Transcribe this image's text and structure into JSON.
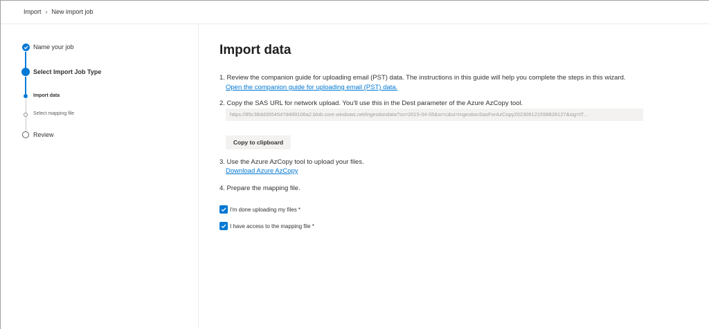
{
  "breadcrumb": {
    "root": "Import",
    "current": "New import job"
  },
  "wizard": {
    "steps": [
      {
        "label": "Name your job",
        "state": "completed"
      },
      {
        "label": "Select Import Job Type",
        "state": "current"
      },
      {
        "label": "Import data",
        "state": "current-substep"
      },
      {
        "label": "Select mapping file",
        "state": "pending-substep"
      },
      {
        "label": "Review",
        "state": "pending"
      }
    ]
  },
  "main": {
    "title": "Import data",
    "step1_text": "1. Review the companion guide for uploading email (PST) data. The instructions in this guide will help you complete the steps in this wizard.",
    "step1_link": "Open the companion guide for uploading email (PST) data.",
    "step2_text": "2. Copy the SAS URL for network upload. You'll use this in the Dest parameter of the Azure AzCopy tool.",
    "sas_url": "https://85c38dd3654547d489106a2.blob.core.windows.net/ingestiondata?sv=2015-04-05&sr=c&si=IngestionSasForAzCopy202306121558828127&sig=tT...",
    "copy_button": "Copy to clipboard",
    "step3_text": "3. Use the Azure AzCopy tool to upload your files.",
    "step3_link": "Download Azure AzCopy",
    "step4_text": "4. Prepare the mapping file.",
    "checkbox1_label": "I'm done uploading my files *",
    "checkbox1_checked": true,
    "checkbox2_label": "I have access to the mapping file *",
    "checkbox2_checked": true
  },
  "colors": {
    "accent": "#0078d4",
    "text": "#323130",
    "muted": "#a19f9d"
  }
}
